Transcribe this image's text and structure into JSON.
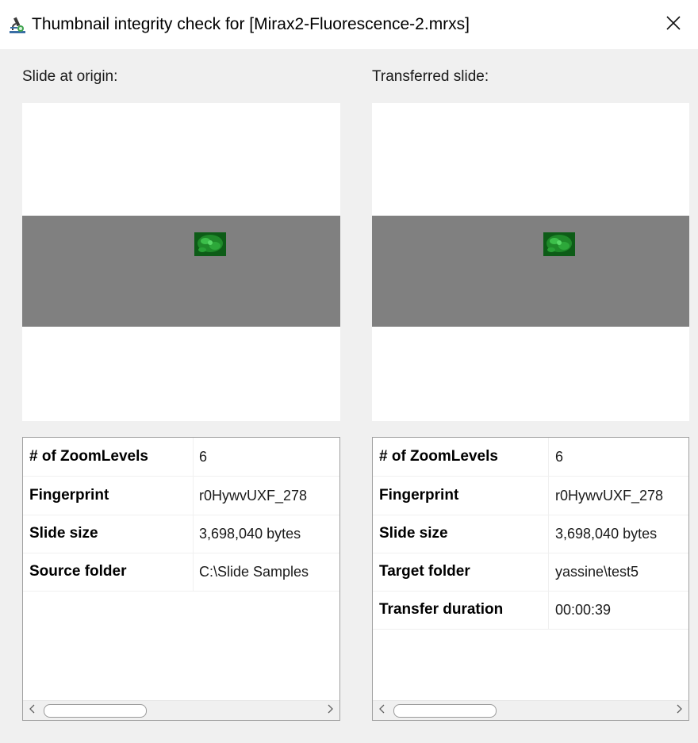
{
  "window": {
    "title": "Thumbnail integrity check for [Mirax2-Fluorescence-2.mrxs]",
    "app_icon": "microscope-icon",
    "close_icon": "close-icon"
  },
  "origin": {
    "label": "Slide at origin:",
    "rows": [
      {
        "key": "# of ZoomLevels",
        "value": "6"
      },
      {
        "key": "Fingerprint",
        "value": "r0HywvUXF_278"
      },
      {
        "key": "Slide size",
        "value": "3,698,040 bytes"
      },
      {
        "key": "Source folder",
        "value": "C:\\Slide Samples"
      }
    ]
  },
  "transferred": {
    "label": "Transferred slide:",
    "rows": [
      {
        "key": "# of ZoomLevels",
        "value": "6"
      },
      {
        "key": "Fingerprint",
        "value": "r0HywvUXF_278"
      },
      {
        "key": "Slide size",
        "value": "3,698,040 bytes"
      },
      {
        "key": "Target folder",
        "value": "yassine\\test5"
      },
      {
        "key": "Transfer duration",
        "value": "00:00:39"
      }
    ]
  },
  "colors": {
    "slide_band": "#808080",
    "tissue": "#1f8a2a",
    "window_bg": "#f0f0f0"
  }
}
